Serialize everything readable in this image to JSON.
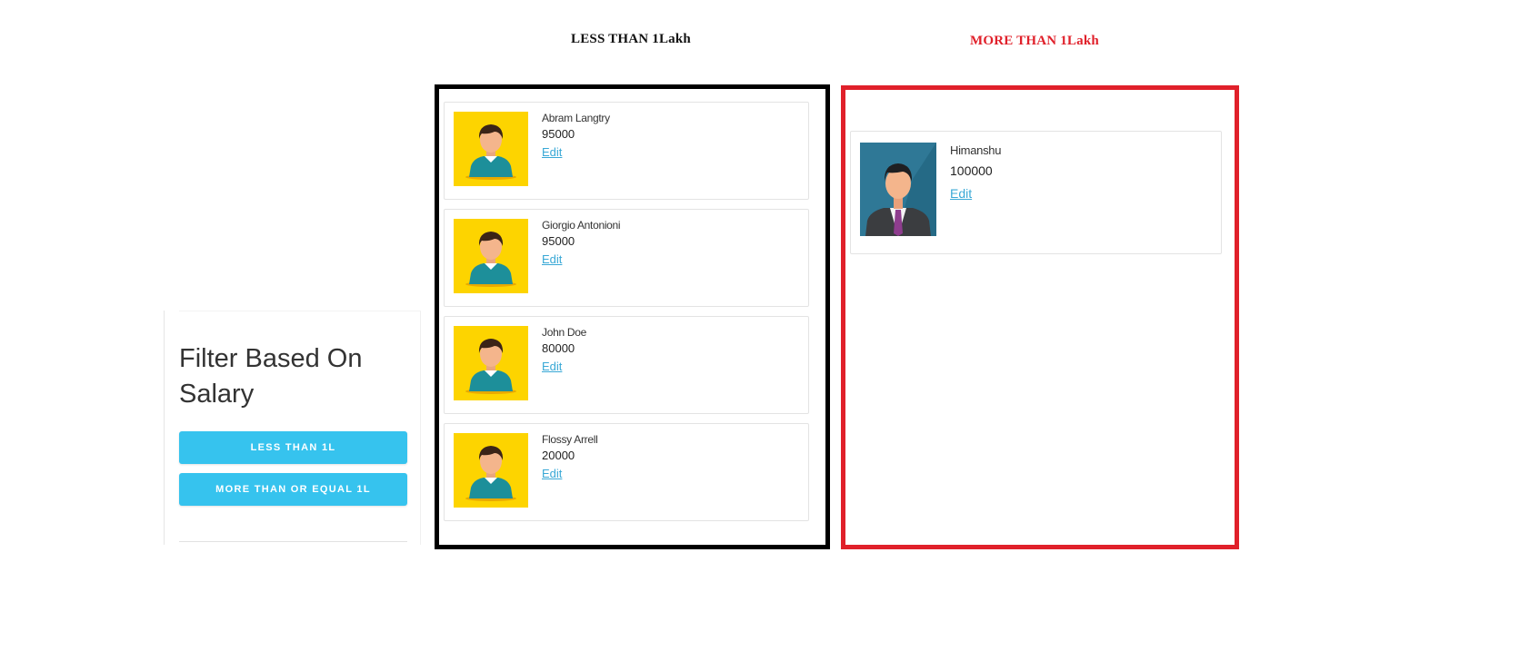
{
  "headings": {
    "less": "LESS THAN 1Lakh",
    "more": "MORE THAN 1Lakh"
  },
  "filter": {
    "title": "Filter Based On Salary",
    "less_button": "LESS THAN 1L",
    "more_button": "MORE THAN OR EQUAL 1L"
  },
  "less_list": [
    {
      "name": "Abram Langtry",
      "salary": "95000",
      "edit_label": "Edit",
      "avatar_icon": "casual-person-avatar-icon"
    },
    {
      "name": "Giorgio Antonioni",
      "salary": "95000",
      "edit_label": "Edit",
      "avatar_icon": "casual-person-avatar-icon"
    },
    {
      "name": "John Doe",
      "salary": "80000",
      "edit_label": "Edit",
      "avatar_icon": "casual-person-avatar-icon"
    },
    {
      "name": "Flossy Arrell",
      "salary": "20000",
      "edit_label": "Edit",
      "avatar_icon": "casual-person-avatar-icon"
    }
  ],
  "more_list": [
    {
      "name": "Himanshu",
      "salary": "100000",
      "edit_label": "Edit",
      "avatar_icon": "business-person-avatar-icon"
    }
  ],
  "colors": {
    "accent_button": "#36c3ee",
    "less_border": "#000000",
    "more_border": "#e0202a",
    "link": "#39a8d6",
    "avatar_casual_bg": "#fdd400",
    "avatar_business_bg": "#2f7896"
  }
}
